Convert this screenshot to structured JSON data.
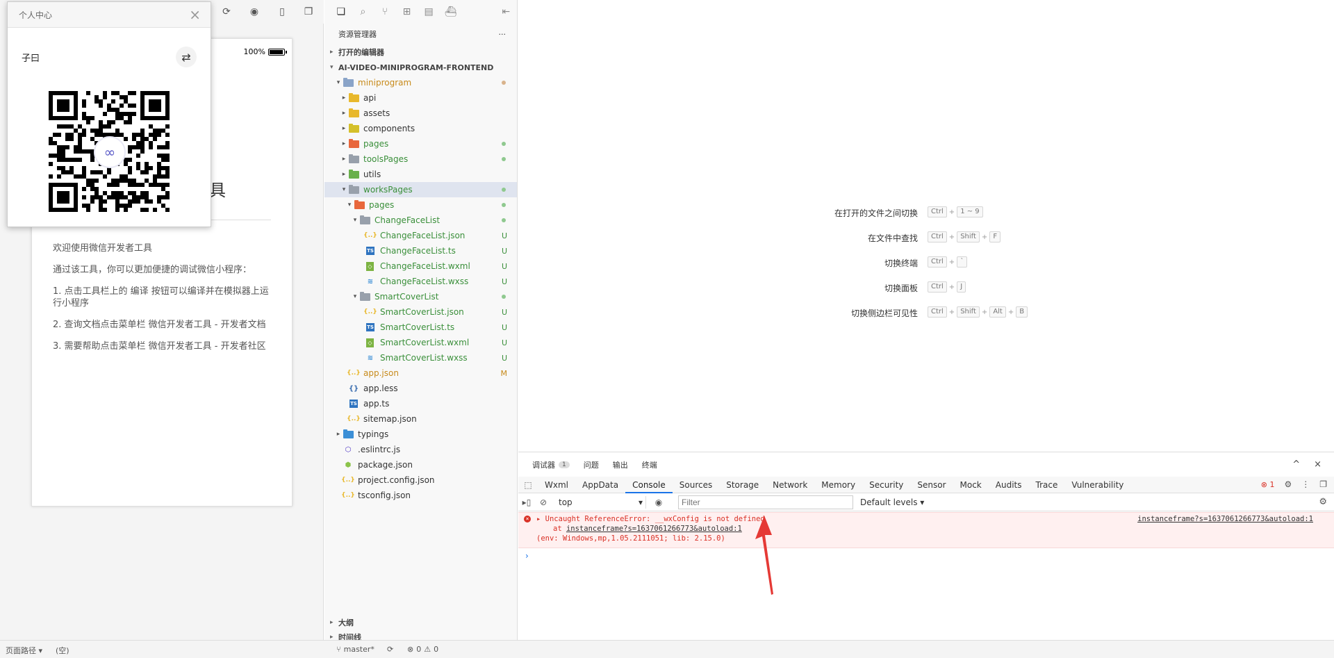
{
  "popup": {
    "title": "个人中心",
    "username": "子曰",
    "close_symbol": "×",
    "switch_icon": "swap-icon",
    "qr_logo_icon": "miniprogram-logo-icon"
  },
  "simulator": {
    "battery_percent": "100%",
    "title_partial": "具",
    "content": [
      "欢迎使用微信开发者工具",
      "通过该工具，你可以更加便捷的调试微信小程序：",
      "1. 点击工具栏上的 编译 按钮可以编译并在模拟器上运行小程序",
      "2. 查询文档点击菜单栏 微信开发者工具 - 开发者文档",
      "3. 需要帮助点击菜单栏 微信开发者工具 - 开发者社区"
    ]
  },
  "explorer": {
    "title": "资源管理器",
    "more": "···",
    "open_editors": "打开的编辑器",
    "project": "AI-VIDEO-MINIPROGRAM-FRONTEND",
    "outline": "大纲",
    "timeline": "时间线",
    "tree": [
      {
        "label": "miniprogram",
        "depth": 0,
        "type": "folder",
        "color": "#8aa4c8",
        "open": true,
        "status": "dot",
        "status_color": "#d9b38c",
        "text_color": "#c78a1a"
      },
      {
        "label": "api",
        "depth": 1,
        "type": "folder",
        "color": "#e8b82c",
        "open": false
      },
      {
        "label": "assets",
        "depth": 1,
        "type": "folder",
        "color": "#e8b82c",
        "open": false
      },
      {
        "label": "components",
        "depth": 1,
        "type": "folder",
        "color": "#d4c02a",
        "open": false
      },
      {
        "label": "pages",
        "depth": 1,
        "type": "folder",
        "color": "#e8673c",
        "open": false,
        "status": "dot",
        "status_color": "#8fc98f",
        "text_color": "#3a8f3a"
      },
      {
        "label": "toolsPages",
        "depth": 1,
        "type": "folder",
        "color": "#98a0ab",
        "open": false,
        "status": "dot",
        "status_color": "#8fc98f",
        "text_color": "#3a8f3a"
      },
      {
        "label": "utils",
        "depth": 1,
        "type": "folder",
        "color": "#6ab04c",
        "open": false
      },
      {
        "label": "worksPages",
        "depth": 1,
        "type": "folder",
        "color": "#98a0ab",
        "open": true,
        "status": "dot",
        "status_color": "#8fc98f",
        "text_color": "#3a8f3a",
        "selected": true
      },
      {
        "label": "pages",
        "depth": 2,
        "type": "folder",
        "color": "#e8673c",
        "open": true,
        "status": "dot",
        "status_color": "#8fc98f",
        "text_color": "#3a8f3a"
      },
      {
        "label": "ChangeFaceList",
        "depth": 3,
        "type": "folder",
        "color": "#98a0ab",
        "open": true,
        "status": "dot",
        "status_color": "#8fc98f",
        "text_color": "#3a8f3a"
      },
      {
        "label": "ChangeFaceList.json",
        "depth": 4,
        "type": "json",
        "status": "U",
        "text_color": "#3a8f3a"
      },
      {
        "label": "ChangeFaceList.ts",
        "depth": 4,
        "type": "ts",
        "status": "U",
        "text_color": "#3a8f3a"
      },
      {
        "label": "ChangeFaceList.wxml",
        "depth": 4,
        "type": "wxml",
        "status": "U",
        "text_color": "#3a8f3a"
      },
      {
        "label": "ChangeFaceList.wxss",
        "depth": 4,
        "type": "wxss",
        "status": "U",
        "text_color": "#3a8f3a"
      },
      {
        "label": "SmartCoverList",
        "depth": 3,
        "type": "folder",
        "color": "#98a0ab",
        "open": true,
        "status": "dot",
        "status_color": "#8fc98f",
        "text_color": "#3a8f3a"
      },
      {
        "label": "SmartCoverList.json",
        "depth": 4,
        "type": "json",
        "status": "U",
        "text_color": "#3a8f3a"
      },
      {
        "label": "SmartCoverList.ts",
        "depth": 4,
        "type": "ts",
        "status": "U",
        "text_color": "#3a8f3a"
      },
      {
        "label": "SmartCoverList.wxml",
        "depth": 4,
        "type": "wxml",
        "status": "U",
        "text_color": "#3a8f3a"
      },
      {
        "label": "SmartCoverList.wxss",
        "depth": 4,
        "type": "wxss",
        "status": "U",
        "text_color": "#3a8f3a"
      },
      {
        "label": "app.json",
        "depth": 1,
        "type": "json",
        "status": "M",
        "text_color": "#c78a1a",
        "leaf": true
      },
      {
        "label": "app.less",
        "depth": 1,
        "type": "less",
        "leaf": true
      },
      {
        "label": "app.ts",
        "depth": 1,
        "type": "ts",
        "leaf": true
      },
      {
        "label": "sitemap.json",
        "depth": 1,
        "type": "json",
        "leaf": true
      },
      {
        "label": "typings",
        "depth": 0,
        "type": "folder",
        "color": "#3c8fd6",
        "open": false
      },
      {
        "label": ".eslintrc.js",
        "depth": 0,
        "type": "eslint",
        "leaf": true
      },
      {
        "label": "package.json",
        "depth": 0,
        "type": "npm",
        "leaf": true
      },
      {
        "label": "project.config.json",
        "depth": 0,
        "type": "json",
        "leaf": true
      },
      {
        "label": "tsconfig.json",
        "depth": 0,
        "type": "json",
        "leaf": true
      }
    ]
  },
  "editor": {
    "shortcuts": [
      {
        "label": "在打开的文件之间切换",
        "keys": [
          "Ctrl",
          "1 ~ 9"
        ]
      },
      {
        "label": "在文件中查找",
        "keys": [
          "Ctrl",
          "Shift",
          "F"
        ]
      },
      {
        "label": "切换终端",
        "keys": [
          "Ctrl",
          "`"
        ]
      },
      {
        "label": "切换面板",
        "keys": [
          "Ctrl",
          "J"
        ]
      },
      {
        "label": "切换侧边栏可见性",
        "keys": [
          "Ctrl",
          "Shift",
          "Alt",
          "B"
        ]
      }
    ]
  },
  "devtools": {
    "top_tabs": [
      {
        "label": "调试器",
        "badge": "1"
      },
      {
        "label": "问题"
      },
      {
        "label": "输出"
      },
      {
        "label": "终端"
      }
    ],
    "collapse_symbol": "^",
    "close_symbol": "×",
    "tabs": [
      "Wxml",
      "AppData",
      "Console",
      "Sources",
      "Storage",
      "Network",
      "Memory",
      "Security",
      "Sensor",
      "Mock",
      "Audits",
      "Trace",
      "Vulnerability"
    ],
    "active_tab": "Console",
    "error_count": "1",
    "context": "top",
    "filter_placeholder": "Filter",
    "levels": "Default levels ▾",
    "error": {
      "message": "Uncaught ReferenceError: __wxConfig is not defined",
      "at_prefix": "at ",
      "at_link": "instanceframe?s=1637061266773&autoload:1",
      "env": "(env: Windows,mp,1.05.2111051; lib: 2.15.0)",
      "source": "instanceframe?s=1637061266773&autoload:1"
    },
    "prompt": "›"
  },
  "statusbar": {
    "page_path": "页面路径 ▾",
    "page_path_value": "(空)",
    "branch": "master*",
    "errors": "0",
    "warnings": "0"
  },
  "colors": {
    "accent": "#1a73e8",
    "error": "#d93025",
    "git_untracked": "#3a8f3a",
    "git_modified": "#c78a1a",
    "annotation_arrow": "#e53935"
  }
}
